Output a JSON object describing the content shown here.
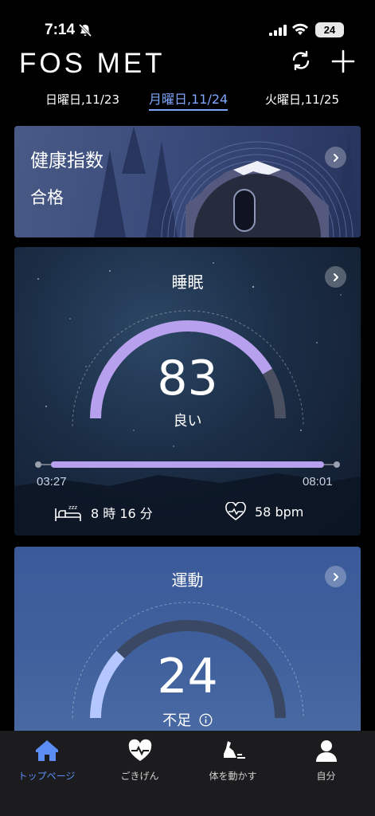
{
  "status_bar": {
    "time": "7:14",
    "battery": "24"
  },
  "header": {
    "logo": "FOS MET"
  },
  "dates": {
    "prev": "日曜日,11/23",
    "current": "月曜日,11/24",
    "next": "火曜日,11/25"
  },
  "health_card": {
    "title": "健康指数",
    "status": "合格"
  },
  "sleep_card": {
    "title": "睡眠",
    "score": "83",
    "rating": "良い",
    "score_fraction": 0.83,
    "start_time": "03:27",
    "end_time": "08:01",
    "duration": "8 時 16 分",
    "heart_rate": "58 bpm"
  },
  "exercise_card": {
    "title": "運動",
    "score": "24",
    "rating": "不足",
    "score_fraction": 0.24
  },
  "tabs": [
    {
      "label": "トップページ",
      "icon": "home-icon",
      "active": true
    },
    {
      "label": "ごきげん",
      "icon": "heart-pulse-icon",
      "active": false
    },
    {
      "label": "体を動かす",
      "icon": "running-shoe-icon",
      "active": false
    },
    {
      "label": "自分",
      "icon": "person-icon",
      "active": false
    }
  ],
  "colors": {
    "accent": "#5b8df5",
    "sleep_arc": "#b7a1ee",
    "exercise_arc": "#b4c8ff"
  }
}
